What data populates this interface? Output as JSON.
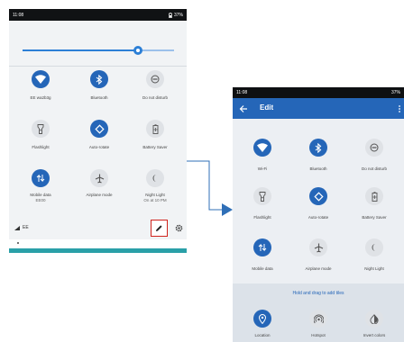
{
  "left_phone": {
    "status_bar": {
      "time": "11:08",
      "battery": "37%"
    },
    "brightness_level": 0.76,
    "tiles": [
      {
        "label": "EE wa2b3g",
        "icon": "wifi-icon",
        "active": true
      },
      {
        "label": "Bluetooth",
        "icon": "bluetooth-icon",
        "active": true
      },
      {
        "label": "Do not disturb",
        "icon": "dnd-icon",
        "active": false
      },
      {
        "label": "Flashlight",
        "icon": "flashlight-icon",
        "active": false
      },
      {
        "label": "Auto-rotate",
        "icon": "rotate-icon",
        "active": true
      },
      {
        "label": "Battery Saver",
        "icon": "battery-saver-icon",
        "active": false
      },
      {
        "label": "Mobile data",
        "sub": "EE00",
        "icon": "mobile-data-icon",
        "active": true
      },
      {
        "label": "Airplane mode",
        "icon": "airplane-icon",
        "active": false
      },
      {
        "label": "Night Light",
        "sub": "On at 10 PM",
        "icon": "night-light-icon",
        "active": false
      }
    ],
    "footer": {
      "network": "EE"
    }
  },
  "right_phone": {
    "status_bar": {
      "time": "11:08",
      "battery": "37%"
    },
    "appbar_title": "Edit",
    "tiles": [
      {
        "label": "Wi-Fi",
        "icon": "wifi-icon",
        "active": true
      },
      {
        "label": "Bluetooth",
        "icon": "bluetooth-icon",
        "active": true
      },
      {
        "label": "Do not disturb",
        "icon": "dnd-icon",
        "active": false
      },
      {
        "label": "Flashlight",
        "icon": "flashlight-icon",
        "active": false
      },
      {
        "label": "Auto-rotate",
        "icon": "rotate-icon",
        "active": true
      },
      {
        "label": "Battery Saver",
        "icon": "battery-saver-icon",
        "active": false
      },
      {
        "label": "Mobile data",
        "icon": "mobile-data-icon",
        "active": true
      },
      {
        "label": "Airplane mode",
        "icon": "airplane-icon",
        "active": false
      },
      {
        "label": "Night Light",
        "icon": "night-light-icon",
        "active": false
      }
    ],
    "drag_hint": "Hold and drag to add tiles",
    "extra_tiles": [
      {
        "label": "Location",
        "icon": "location-icon",
        "active": true
      },
      {
        "label": "Hotspot",
        "icon": "hotspot-icon",
        "active": false
      },
      {
        "label": "Invert colors",
        "icon": "invert-colors-icon",
        "active": false
      }
    ]
  },
  "colors": {
    "accent": "#2566b8",
    "highlight": "#d0231d",
    "connector": "#2f6fb7"
  }
}
